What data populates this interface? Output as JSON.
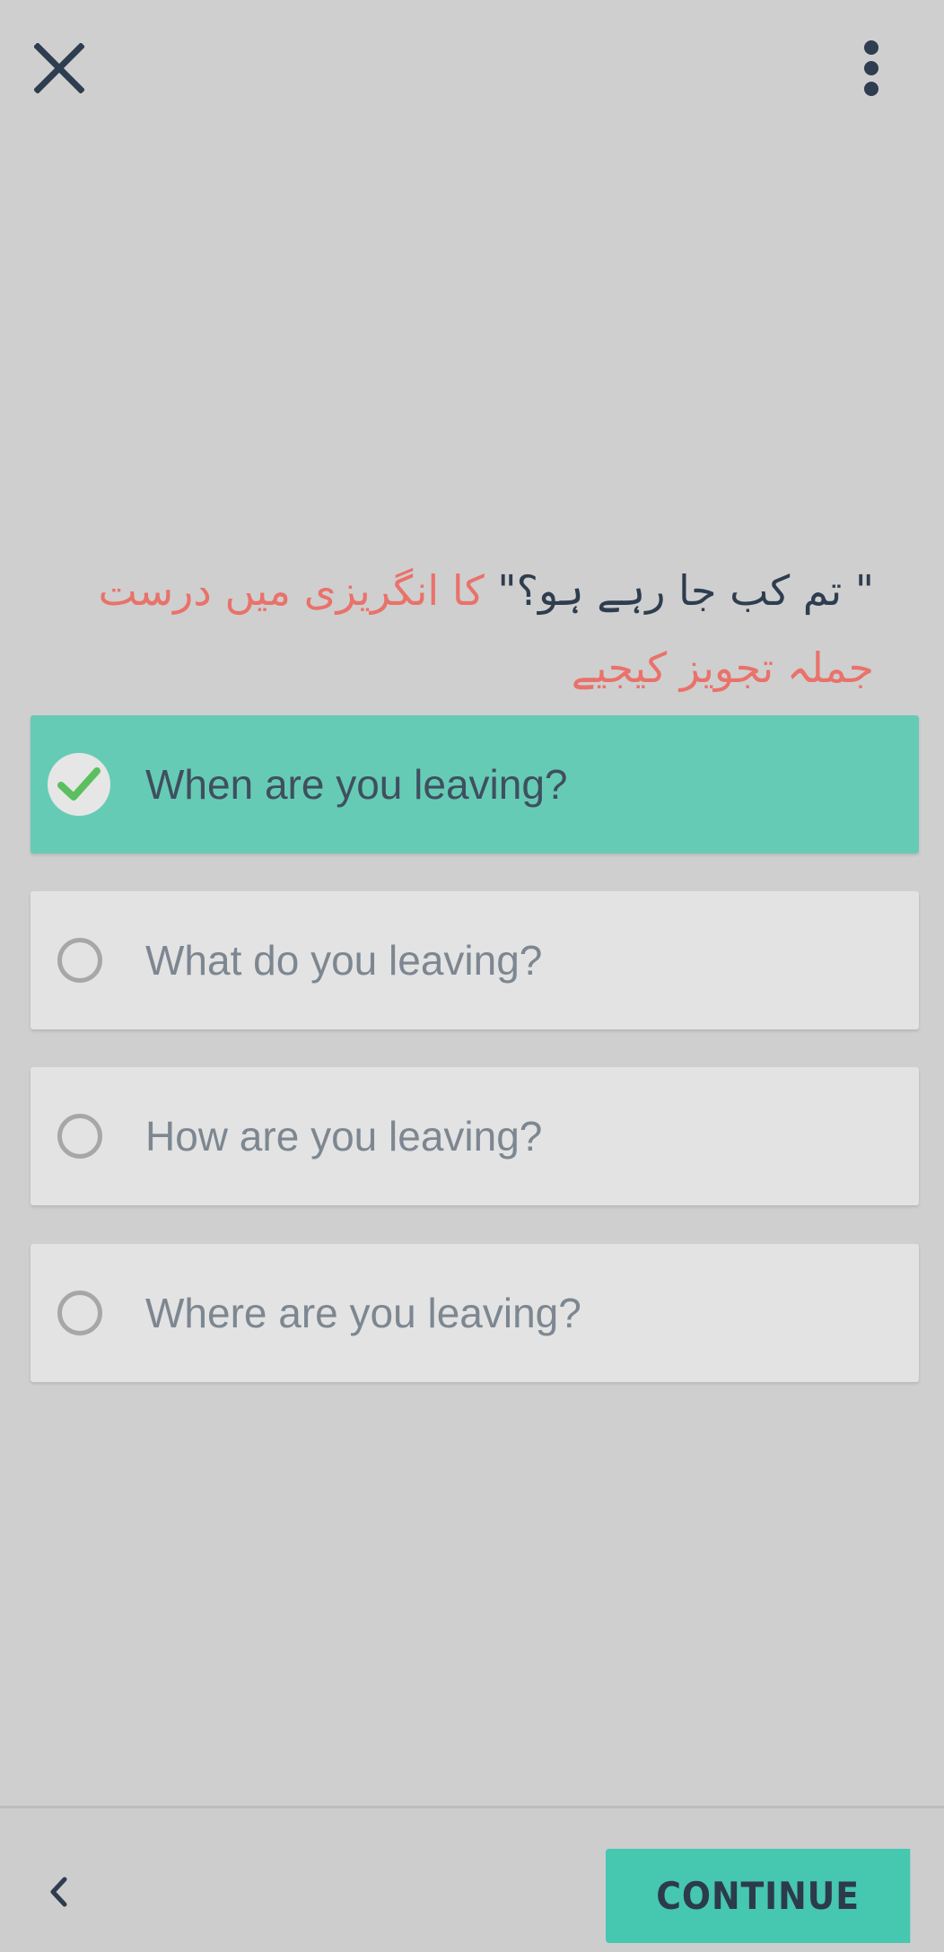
{
  "header": {
    "close_icon": "close-icon",
    "more_icon": "more-vertical-icon"
  },
  "question": {
    "quoted_text": "\" تم کب جا رہے ہو؟\"",
    "instruction_text": " کا انگریزی میں درست جملہ تجویز کیجیے"
  },
  "options": [
    {
      "label": "When are you leaving?",
      "selected": true
    },
    {
      "label": "What do you leaving?",
      "selected": false
    },
    {
      "label": "How are you leaving?",
      "selected": false
    },
    {
      "label": "Where are you leaving?",
      "selected": false
    }
  ],
  "footer": {
    "back_icon": "chevron-left-icon",
    "continue_label": "CONTINUE"
  },
  "colors": {
    "background": "#cfcfcf",
    "selected_option": "#66cbb5",
    "unselected_option": "#e3e3e3",
    "continue_button": "#46c7b0",
    "instruction_text": "#e9726a",
    "primary_text": "#2e3d4f",
    "check_mark": "#5bbf5f"
  }
}
